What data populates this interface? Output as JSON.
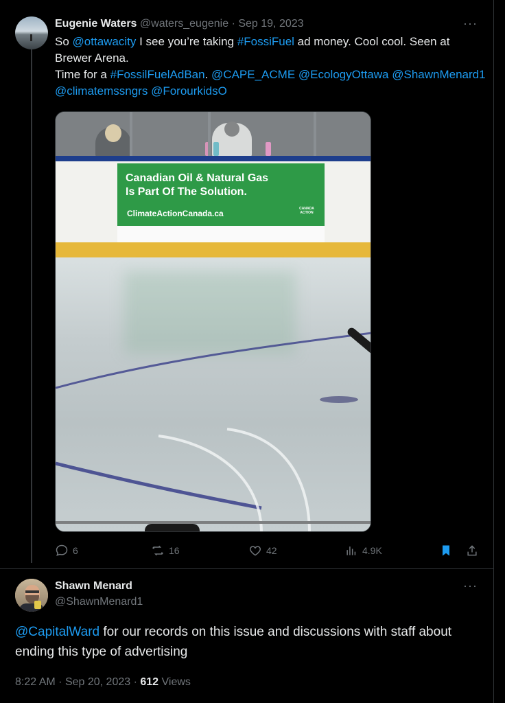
{
  "tweet1": {
    "display_name": "Eugenie Waters",
    "handle": "@waters_eugenie",
    "separator": "·",
    "date": "Sep 19, 2023",
    "more": "···",
    "segments": [
      {
        "t": "So ",
        "link": false
      },
      {
        "t": "@ottawacity",
        "link": true
      },
      {
        "t": " I see you’re taking ",
        "link": false
      },
      {
        "t": "#FossiFuel",
        "link": true
      },
      {
        "t": " ad money. Cool cool. Seen at Brewer Arena.",
        "link": false
      },
      {
        "t": "\n",
        "link": false
      },
      {
        "t": "Time for a ",
        "link": false
      },
      {
        "t": "#FossilFuelAdBan",
        "link": true
      },
      {
        "t": ". ",
        "link": false
      },
      {
        "t": "@CAPE_ACME",
        "link": true
      },
      {
        "t": " ",
        "link": false
      },
      {
        "t": "@EcologyOttawa",
        "link": true
      },
      {
        "t": " ",
        "link": false
      },
      {
        "t": "@ShawnMenard1",
        "link": true
      },
      {
        "t": " ",
        "link": false
      },
      {
        "t": "@climatemssngrs",
        "link": true
      },
      {
        "t": " ",
        "link": false
      },
      {
        "t": "@ForourkidsO",
        "link": true
      }
    ],
    "photo": {
      "ad_line1": "Canadian Oil & Natural Gas",
      "ad_line2": "Is Part Of The Solution.",
      "ad_url": "ClimateActionCanada.ca",
      "ad_logo_text": "CANADA ACTION"
    },
    "actions": {
      "replies": "6",
      "retweets": "16",
      "likes": "42",
      "views": "4.9K"
    },
    "colors": {
      "link": "#1d9bf0",
      "bookmark": "#1d9bf0"
    }
  },
  "tweet2": {
    "display_name": "Shawn Menard",
    "handle": "@ShawnMenard1",
    "more": "···",
    "mention": "@CapitalWard",
    "body": " for our records on this issue and discussions with staff about ending this type of advertising",
    "time": "8:22 AM",
    "separator": "·",
    "date": "Sep 20, 2023",
    "separator2": "·",
    "views_count": "612",
    "views_label": "Views"
  }
}
